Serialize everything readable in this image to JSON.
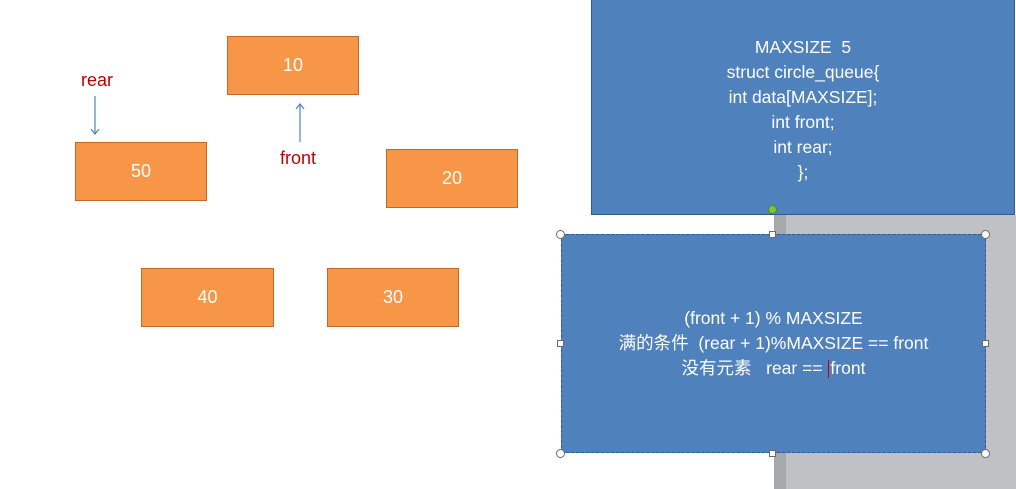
{
  "nodes": {
    "n10": "10",
    "n20": "20",
    "n30": "30",
    "n40": "40",
    "n50": "50"
  },
  "labels": {
    "rear": "rear",
    "front": "front"
  },
  "struct_box": {
    "lines": [
      "MAXSIZE  5",
      "struct circle_queue{",
      "int data[MAXSIZE];",
      "int front;",
      "int rear;",
      "};"
    ]
  },
  "condition_box": {
    "line1": "(front + 1) % MAXSIZE",
    "line2": "满的条件  (rear + 1)%MAXSIZE == front",
    "line3_prefix": "没有元素   rear ==",
    "line3_suffix": "front"
  },
  "colors": {
    "node_fill": "#f79646",
    "box_fill": "#4f81bd",
    "label_red": "#c00000",
    "arrow": "#4f81bd"
  }
}
